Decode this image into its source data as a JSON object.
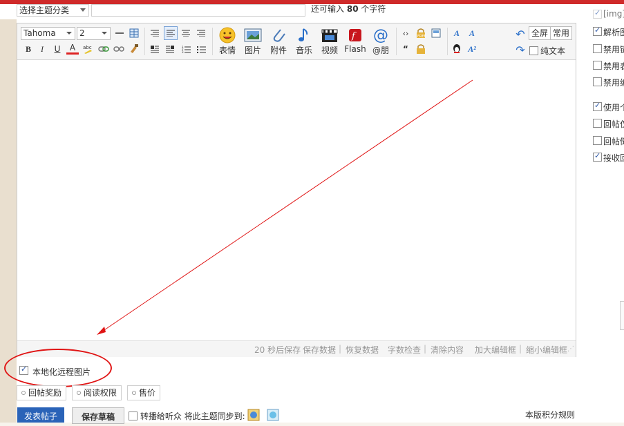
{
  "header": {
    "topic_select": "选择主题分类",
    "char_hint_prefix": "还可输入",
    "char_hint_count": "80",
    "char_hint_suffix": "个字符"
  },
  "toolbar": {
    "font_family": "Tahoma",
    "font_size": "2",
    "bold": "B",
    "italic": "I",
    "underline": "U",
    "font_color": "A",
    "emoticon": "表情",
    "image": "图片",
    "attachment": "附件",
    "music": "音乐",
    "video": "视频",
    "flash": "Flash",
    "at": "@朋",
    "fullscreen": "全屏",
    "common": "常用",
    "plain_text": "纯文本"
  },
  "statusbar": {
    "autosave": "20 秒后保存",
    "save_data": "保存数据",
    "restore_data": "恢复数据",
    "word_check": "字数检查",
    "clear_content": "清除内容",
    "enlarge": "加大编辑框",
    "shrink": "缩小编辑框"
  },
  "options": {
    "localize_remote_images": "本地化远程图片"
  },
  "tabs": [
    "回帖奖励",
    "阅读权限",
    "售价"
  ],
  "actions": {
    "post": "发表帖子",
    "save_draft": "保存草稿",
    "broadcast": "转播给听众",
    "sync_label": "将此主题同步到:",
    "rules": "本版积分规则"
  },
  "right_panel": {
    "items": [
      {
        "label": "[img]",
        "checked": true,
        "disabled": true
      },
      {
        "label": "解析图",
        "checked": true
      },
      {
        "label": "禁用链",
        "checked": false
      },
      {
        "label": "禁用表",
        "checked": false
      },
      {
        "label": "禁用编",
        "checked": false
      },
      {
        "label": "使用个",
        "checked": true
      },
      {
        "label": "回帖仅",
        "checked": false
      },
      {
        "label": "回帖倒",
        "checked": false
      },
      {
        "label": "接收回",
        "checked": true
      }
    ]
  },
  "colors": {
    "accent_red": "#cf2a2a",
    "annotation_red": "#e01515",
    "post_button": "#2a63b8"
  }
}
